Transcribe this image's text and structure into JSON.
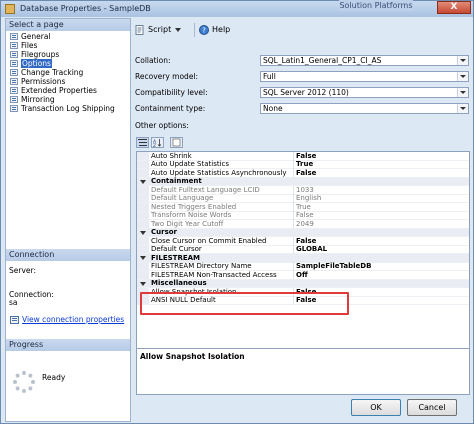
{
  "window": {
    "title": "Database Properties - SampleDB",
    "overlay_text": "Solution Platforms",
    "close_label": "X"
  },
  "left": {
    "select_page_header": "Select a page",
    "pages": [
      {
        "label": "General",
        "selected": false
      },
      {
        "label": "Files",
        "selected": false
      },
      {
        "label": "Filegroups",
        "selected": false
      },
      {
        "label": "Options",
        "selected": true
      },
      {
        "label": "Change Tracking",
        "selected": false
      },
      {
        "label": "Permissions",
        "selected": false
      },
      {
        "label": "Extended Properties",
        "selected": false
      },
      {
        "label": "Mirroring",
        "selected": false
      },
      {
        "label": "Transaction Log Shipping",
        "selected": false
      }
    ],
    "connection_header": "Connection",
    "server_label": "Server:",
    "server_value": "",
    "connection_label": "Connection:",
    "connection_value": "sa",
    "view_connection_link": "View connection properties",
    "progress_header": "Progress",
    "progress_status": "Ready"
  },
  "toolbar": {
    "script_label": "Script",
    "help_label": "Help"
  },
  "options": {
    "collation_label": "Collation:",
    "collation_value": "SQL_Latin1_General_CP1_CI_AS",
    "recovery_label": "Recovery model:",
    "recovery_value": "Full",
    "compat_label": "Compatibility level:",
    "compat_value": "SQL Server 2012 (110)",
    "containment_label": "Containment type:",
    "containment_value": "None",
    "other_options_label": "Other options:"
  },
  "grid": {
    "rows": [
      {
        "name": "Auto Shrink",
        "value": "False",
        "kind": "prop"
      },
      {
        "name": "Auto Update Statistics",
        "value": "True",
        "kind": "prop"
      },
      {
        "name": "Auto Update Statistics Asynchronously",
        "value": "False",
        "kind": "prop"
      },
      {
        "name": "Containment",
        "value": "",
        "kind": "cat"
      },
      {
        "name": "Default Fulltext Language LCID",
        "value": "1033",
        "kind": "dim"
      },
      {
        "name": "Default Language",
        "value": "English",
        "kind": "dim"
      },
      {
        "name": "Nested Triggers Enabled",
        "value": "True",
        "kind": "dim"
      },
      {
        "name": "Transform Noise Words",
        "value": "False",
        "kind": "dim"
      },
      {
        "name": "Two Digit Year Cutoff",
        "value": "2049",
        "kind": "dim"
      },
      {
        "name": "Cursor",
        "value": "",
        "kind": "cat"
      },
      {
        "name": "Close Cursor on Commit Enabled",
        "value": "False",
        "kind": "prop"
      },
      {
        "name": "Default Cursor",
        "value": "GLOBAL",
        "kind": "prop"
      },
      {
        "name": "FILESTREAM",
        "value": "",
        "kind": "cat"
      },
      {
        "name": "FILESTREAM Directory Name",
        "value": "SampleFileTableDB",
        "kind": "prop"
      },
      {
        "name": "FILESTREAM Non-Transacted Access",
        "value": "Off",
        "kind": "prop"
      },
      {
        "name": "Miscellaneous",
        "value": "",
        "kind": "cat"
      },
      {
        "name": "Allow Snapshot Isolation",
        "value": "False",
        "kind": "prop"
      },
      {
        "name": "ANSI NULL Default",
        "value": "False",
        "kind": "prop"
      }
    ]
  },
  "description": {
    "title": "Allow Snapshot Isolation"
  },
  "buttons": {
    "ok_label": "OK",
    "cancel_label": "Cancel"
  }
}
